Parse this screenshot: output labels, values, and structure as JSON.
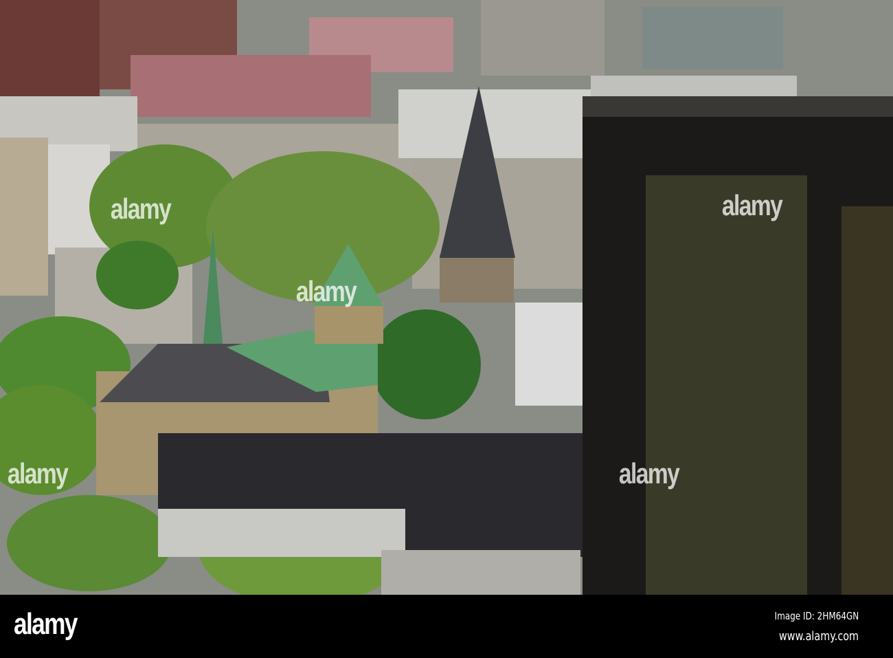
{
  "watermark": {
    "text": "alamy"
  },
  "footer": {
    "logo": "alamy",
    "image_id": "Image ID: 2HM64GN",
    "url": "www.alamy.com"
  },
  "colors": {
    "tree": "#4f7d2a",
    "copper_roof": "#5fa070",
    "tower_glass": "#1c1a18",
    "footer": "#000000"
  }
}
